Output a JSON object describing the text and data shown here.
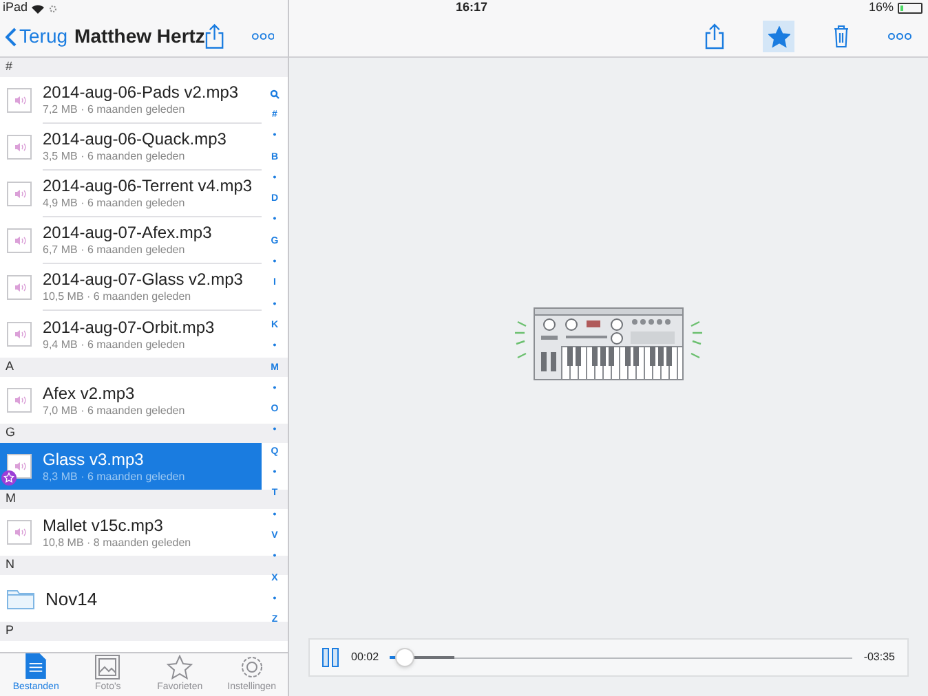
{
  "status_bar": {
    "device": "iPad",
    "time": "16:17",
    "battery": "16%"
  },
  "nav": {
    "back": "Terug",
    "title": "Matthew Hertz"
  },
  "sections": [
    {
      "header": "#",
      "items": [
        {
          "kind": "audio",
          "name": "2014-aug-06-Pads v2.mp3",
          "meta": "7,2 MB · 6 maanden geleden",
          "selected": false,
          "favorite": false
        },
        {
          "kind": "audio",
          "name": "2014-aug-06-Quack.mp3",
          "meta": "3,5 MB · 6 maanden geleden",
          "selected": false,
          "favorite": false
        },
        {
          "kind": "audio",
          "name": "2014-aug-06-Terrent v4.mp3",
          "meta": "4,9 MB · 6 maanden geleden",
          "selected": false,
          "favorite": false
        },
        {
          "kind": "audio",
          "name": "2014-aug-07-Afex.mp3",
          "meta": "6,7 MB · 6 maanden geleden",
          "selected": false,
          "favorite": false
        },
        {
          "kind": "audio",
          "name": "2014-aug-07-Glass v2.mp3",
          "meta": "10,5 MB · 6 maanden geleden",
          "selected": false,
          "favorite": false
        },
        {
          "kind": "audio",
          "name": "2014-aug-07-Orbit.mp3",
          "meta": "9,4 MB · 6 maanden geleden",
          "selected": false,
          "favorite": false
        }
      ]
    },
    {
      "header": "A",
      "items": [
        {
          "kind": "audio",
          "name": "Afex v2.mp3",
          "meta": "7,0 MB · 6 maanden geleden",
          "selected": false,
          "favorite": false
        }
      ]
    },
    {
      "header": "G",
      "items": [
        {
          "kind": "audio",
          "name": "Glass v3.mp3",
          "meta": "8,3 MB · 6 maanden geleden",
          "selected": true,
          "favorite": true
        }
      ]
    },
    {
      "header": "M",
      "items": [
        {
          "kind": "audio",
          "name": "Mallet v15c.mp3",
          "meta": "10,8 MB · 8 maanden geleden",
          "selected": false,
          "favorite": false
        }
      ]
    },
    {
      "header": "N",
      "items": [
        {
          "kind": "folder",
          "name": "Nov14",
          "selected": false,
          "favorite": false
        }
      ]
    },
    {
      "header": "P"
    }
  ],
  "index_bar": [
    "#",
    "•",
    "B",
    "•",
    "D",
    "•",
    "G",
    "•",
    "I",
    "•",
    "K",
    "•",
    "M",
    "•",
    "O",
    "•",
    "Q",
    "•",
    "T",
    "•",
    "V",
    "•",
    "X",
    "•",
    "Z"
  ],
  "toolbar": {
    "favorite": true
  },
  "player": {
    "playing": true,
    "elapsed": "00:02",
    "remaining": "-03:35",
    "level": 0.02
  },
  "tabs": [
    {
      "label": "Bestanden",
      "selected": true
    },
    {
      "label": "Foto's",
      "selected": false
    },
    {
      "label": "Favorieten",
      "selected": false
    },
    {
      "label": "Instellingen",
      "selected": false
    }
  ]
}
